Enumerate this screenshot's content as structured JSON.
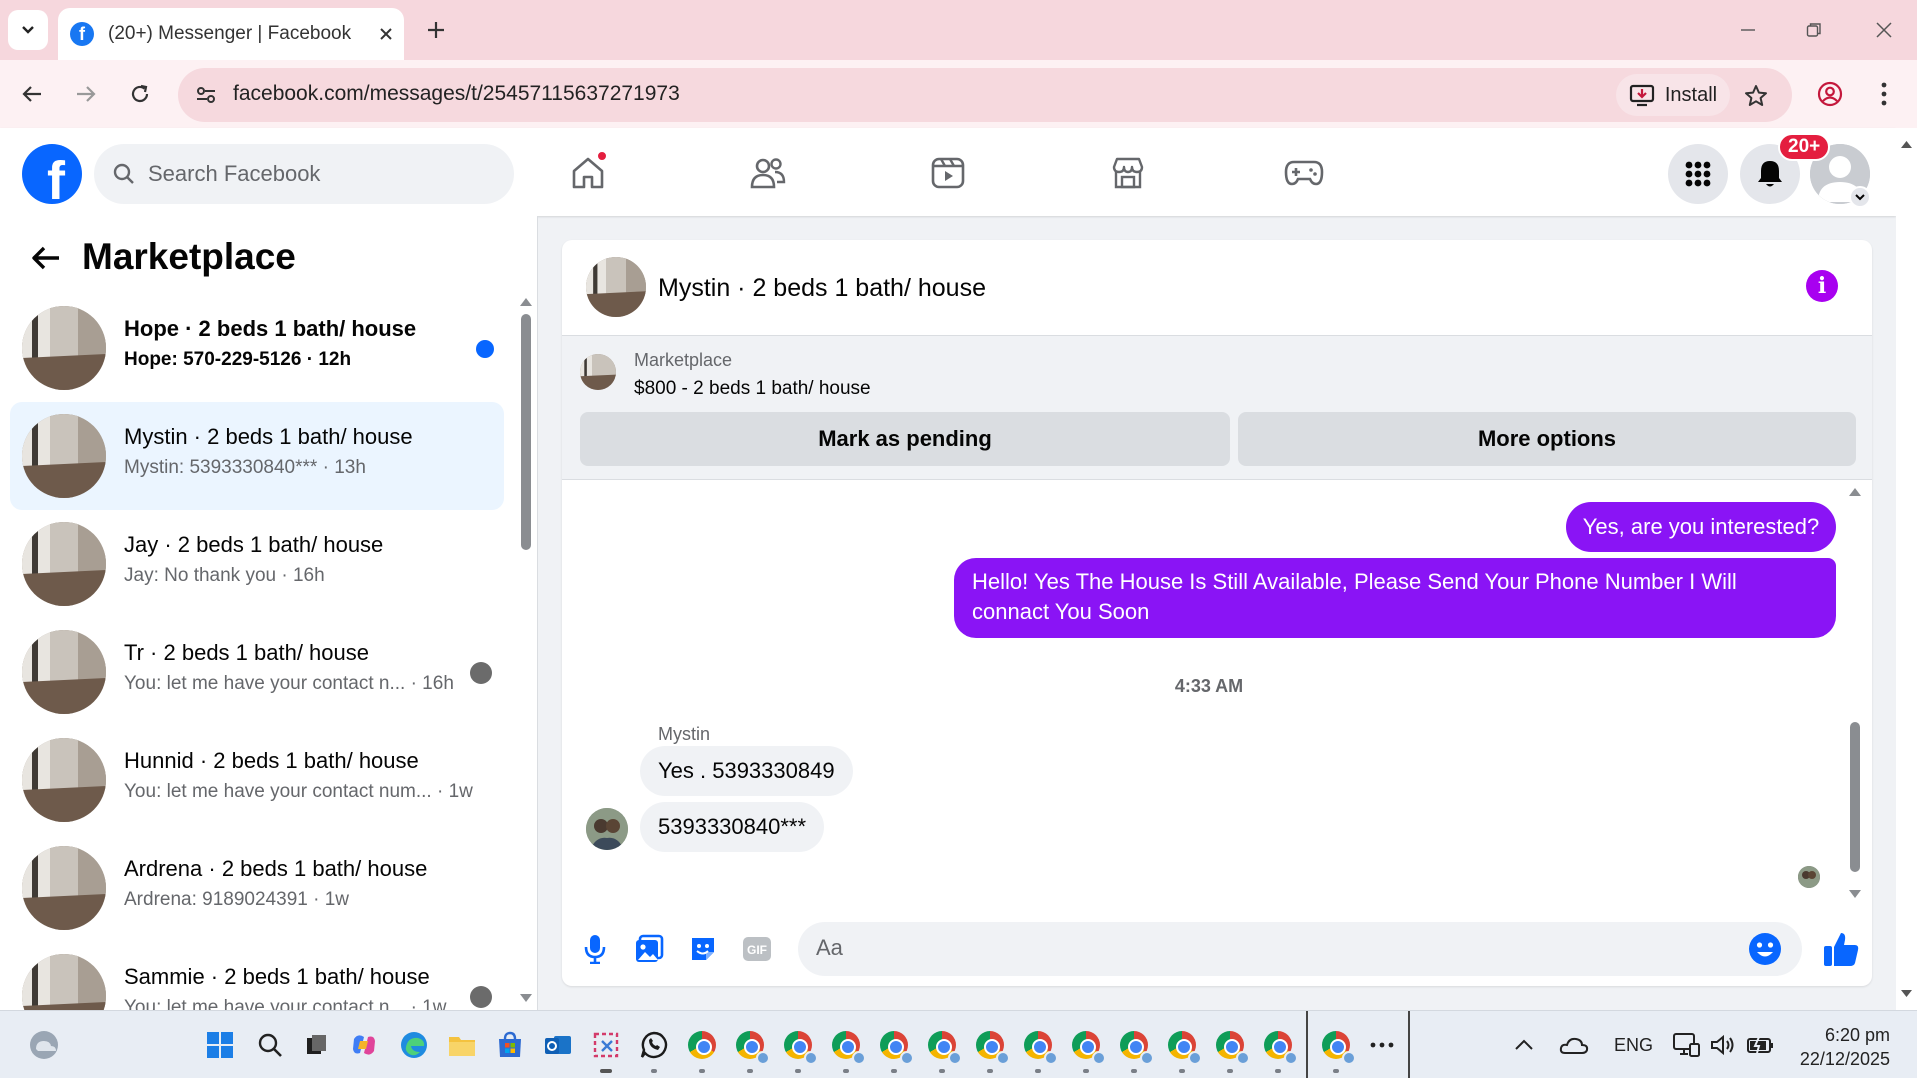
{
  "browser": {
    "tab_title": "(20+) Messenger | Facebook",
    "url": "facebook.com/messages/t/25457115637271973",
    "install_label": "Install"
  },
  "fb": {
    "search_placeholder": "Search Facebook",
    "notification_count": "20+"
  },
  "left": {
    "title": "Marketplace",
    "conversations": [
      {
        "title": "Hope · 2 beds 1 bath/ house",
        "subtitle": "Hope: 570-229-5126 · 12h",
        "unread": true
      },
      {
        "title": "Mystin · 2 beds 1 bath/ house",
        "subtitle": "Mystin: 5393330840*** · 13h",
        "active": true
      },
      {
        "title": "Jay · 2 beds 1 bath/ house",
        "subtitle": "Jay: No thank you · 16h"
      },
      {
        "title": "Tr · 2 beds 1 bath/ house",
        "subtitle": "You: let me have your contact n... · 16h"
      },
      {
        "title": "Hunnid · 2 beds 1 bath/ house",
        "subtitle": "You: let me have your contact num... · 1w"
      },
      {
        "title": "Ardrena · 2 beds 1 bath/ house",
        "subtitle": "Ardrena: 9189024391 · 1w"
      },
      {
        "title": "Sammie · 2 beds 1 bath/ house",
        "subtitle": "You: let me have your contact n... · 1w"
      }
    ]
  },
  "chat": {
    "header_name": "Mystin · 2 beds 1 bath/ house",
    "marketplace_label": "Marketplace",
    "listing": "$800 - 2 beds 1 bath/ house",
    "mark_pending": "Mark as pending",
    "more_options": "More options",
    "messages": {
      "out1": "Yes, are you interested?",
      "out2": "Hello! Yes The House  Is Still Available, Please Send Your Phone Number I Will connact You Soon",
      "time": "4:33 AM",
      "sender": "Mystin",
      "in1": "Yes . 5393330849",
      "in2": "5393330840***"
    },
    "composer_placeholder": "Aa"
  },
  "taskbar": {
    "language": "ENG",
    "time": "6:20 pm",
    "date": "22/12/2025"
  },
  "colors": {
    "brand_blue": "#0866ff",
    "messenger_purple": "#8a14f5",
    "notification_red": "#e41e3f",
    "active_row": "#ebf5ff"
  }
}
